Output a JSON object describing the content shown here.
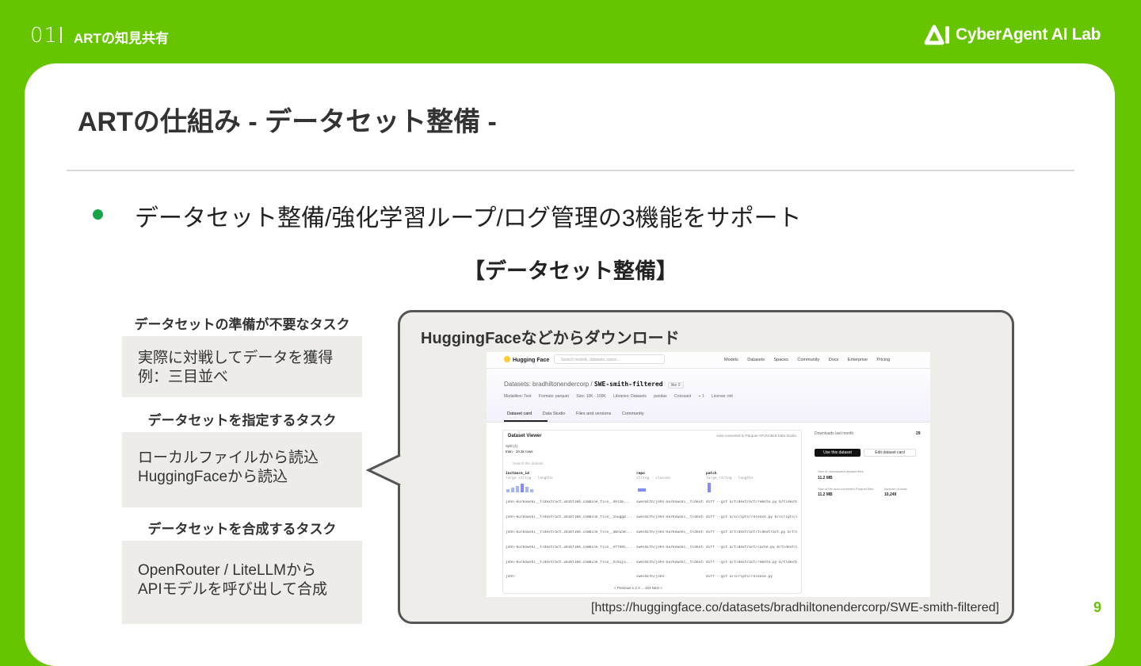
{
  "header": {
    "section_number": "01",
    "section_title": "ARTの知見共有",
    "brand": "CyberAgent AI Lab"
  },
  "slide": {
    "title": "ARTの仕組み - データセット整備 -",
    "bullet": "データセット整備/強化学習ループ/ログ管理の3機能をサポート",
    "subheading": "【データセット整備】",
    "page_number": "9"
  },
  "groups": [
    {
      "label": "データセットの準備が不要なタスク",
      "lines": [
        "実際に対戦してデータを獲得",
        "例：三目並べ"
      ]
    },
    {
      "label": "データセットを指定するタスク",
      "lines": [
        "ローカルファイルから読込",
        "HuggingFaceから読込"
      ]
    },
    {
      "label": "データセットを合成するタスク",
      "lines": [
        "OpenRouter / LiteLLMから",
        "APIモデルを呼び出して合成"
      ]
    }
  ],
  "callout": {
    "title": "HuggingFaceなどからダウンロード",
    "source": "[https://huggingface.co/datasets/bradhiltonendercorp/SWE-smith-filtered]"
  },
  "hf": {
    "logo": "Hugging Face",
    "search_placeholder": "Search models, datasets, users...",
    "nav": [
      "Models",
      "Datasets",
      "Spaces",
      "Community",
      "Docs",
      "Enterprise",
      "Pricing"
    ],
    "breadcrumb_prefix": "Datasets:",
    "owner": "bradhiltonendercorp",
    "dataset": "SWE-smith-filtered",
    "like": "like 0",
    "tags": [
      "Modalities: Text",
      "Formats: parquet",
      "Size: 10K - 100K",
      "Libraries: Datasets",
      "pandas",
      "Croissant",
      "+ 1",
      "License: mit"
    ],
    "tabs": [
      "Dataset card",
      "Data Studio",
      "Files and versions",
      "Community"
    ],
    "viewer_title": "Dataset Viewer",
    "viewer_actions": "Auto-converted to Parquet   API   Embed   Data Studio",
    "split": "Split (1)",
    "split_value": "train · 10.2k rows",
    "search_dataset": "Search this dataset",
    "columns": [
      "instance_id",
      "repo",
      "patch"
    ],
    "column_types": [
      "large_string · lengths",
      "string · classes",
      "large_string · lengths"
    ],
    "rows": [
      [
        "john-kurkowski__tldextract.3d1bf184.combine_file__49lzm...",
        "swesmith/john-kurkowski__tldextract.3d1bf184",
        "diff --git a/tldextract/remote.py b/tldextract/remote.py index fa..."
      ],
      [
        "john-kurkowski__tldextract.3d1bf184.combine_file__5nuggd...",
        "swesmith/john-kurkowski__tldextract.3d1bf184",
        "diff --git a/scripts/release.py b/scripts/release.py index 501..."
      ],
      [
        "john-kurkowski__tldextract.3d1bf184.combine_file__a8cw58...",
        "swesmith/john-kurkowski__tldextract.3d1bf184",
        "diff --git a/tldextract/tldextract.py b/tldextract/tldextract.py"
      ],
      [
        "john-kurkowski__tldextract.3d1bf184.combine_file__effh85...",
        "swesmith/john-kurkowski__tldextract.3d1bf184",
        "diff --git a/tldextract/cache.py b/tldextract/cache.py index 83a..."
      ],
      [
        "john-kurkowski__tldextract.3d1bf184.combine_file__h7m1ju...",
        "swesmith/john-kurkowski__tldextract.3d1bf184",
        "diff --git a/tldextract/remote.py b/tldextract/remote.py index fa..."
      ],
      [
        "john-",
        "swesmith/john-",
        "diff --git a/scripts/release.py"
      ]
    ],
    "pagination": "< Previous   1   2   3   ...   103   Next >",
    "downloads_label": "Downloads last month",
    "downloads_value": "29",
    "use_button": "Use this dataset",
    "edit_button": "Edit dataset card",
    "size_label": "Size of downloaded dataset files:",
    "size_value": "11.2 MB",
    "parquet_label": "Size of the auto-converted Parquet files:",
    "parquet_value": "11.2 MB",
    "rows_label": "Number of rows:",
    "rows_value": "10,249"
  }
}
